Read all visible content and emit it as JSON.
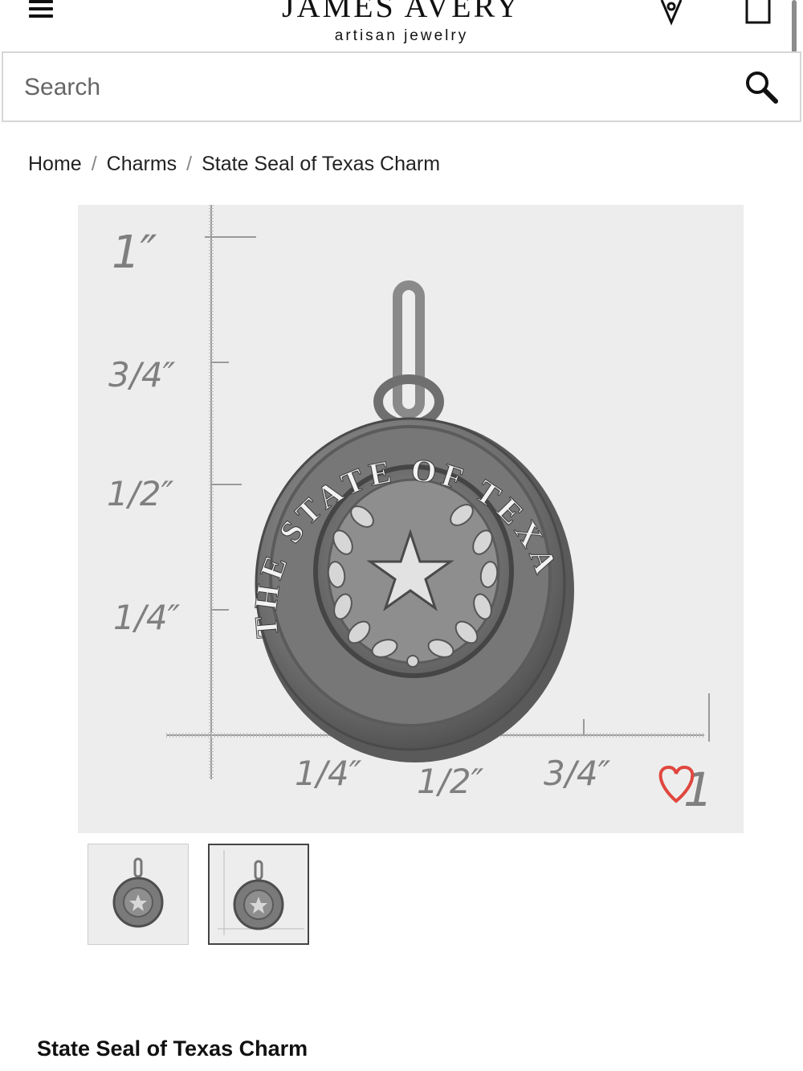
{
  "header": {
    "logo_main": "JAMES AVERY",
    "logo_sub": "artisan jewelry",
    "menu_icon": "hamburger-icon",
    "store_icon": "location-pin-icon",
    "bag_icon": "shopping-bag-icon"
  },
  "search": {
    "placeholder": "Search",
    "value": "",
    "icon": "search-icon"
  },
  "breadcrumb": {
    "items": [
      {
        "label": "Home"
      },
      {
        "label": "Charms"
      },
      {
        "label": "State Seal of Texas Charm"
      }
    ],
    "separator": "/"
  },
  "product_image": {
    "seal_text": "THE STATE OF TEXAS",
    "ruler_vertical": [
      "1″",
      "3/4″",
      "1/2″",
      "1/4″"
    ],
    "ruler_horizontal": [
      "1/4″",
      "1/2″",
      "3/4″",
      "1"
    ],
    "heart_icon": "heart-icon",
    "heart_color": "#e0473f"
  },
  "thumbnails": [
    {
      "name": "charm-front",
      "selected": false
    },
    {
      "name": "charm-scale",
      "selected": true
    }
  ],
  "product": {
    "title": "State Seal of Texas Charm"
  }
}
